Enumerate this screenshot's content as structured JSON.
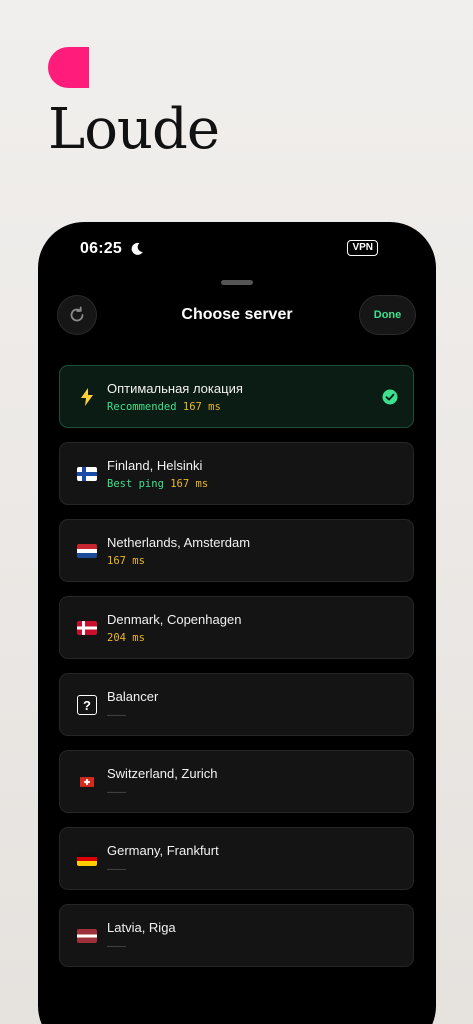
{
  "brand": {
    "name": "Loude",
    "accent": "#ff1c7a"
  },
  "status_bar": {
    "time": "06:25",
    "vpn": "VPN"
  },
  "header": {
    "title": "Choose server",
    "done_label": "Done"
  },
  "colors": {
    "green": "#3fe08d",
    "amber": "#e9b627"
  },
  "servers": [
    {
      "name": "Оптимальная локация",
      "tag": "Recommended",
      "ping": "167 ms",
      "icon": "lightning-icon",
      "selected": true
    },
    {
      "name": "Finland, Helsinki",
      "tag": "Best ping",
      "ping": "167 ms",
      "icon": "finland-flag-icon"
    },
    {
      "name": "Netherlands, Amsterdam",
      "tag": "",
      "ping": "167 ms",
      "icon": "netherlands-flag-icon"
    },
    {
      "name": "Denmark, Copenhagen",
      "tag": "",
      "ping": "204 ms",
      "icon": "denmark-flag-icon"
    },
    {
      "name": "Balancer",
      "ping": "———",
      "icon": "question-box-icon"
    },
    {
      "name": "Switzerland, Zurich",
      "ping": "———",
      "icon": "switzerland-flag-icon"
    },
    {
      "name": "Germany, Frankfurt",
      "ping": "———",
      "icon": "germany-flag-icon"
    },
    {
      "name": "Latvia, Riga",
      "ping": "———",
      "icon": "latvia-flag-icon"
    }
  ]
}
